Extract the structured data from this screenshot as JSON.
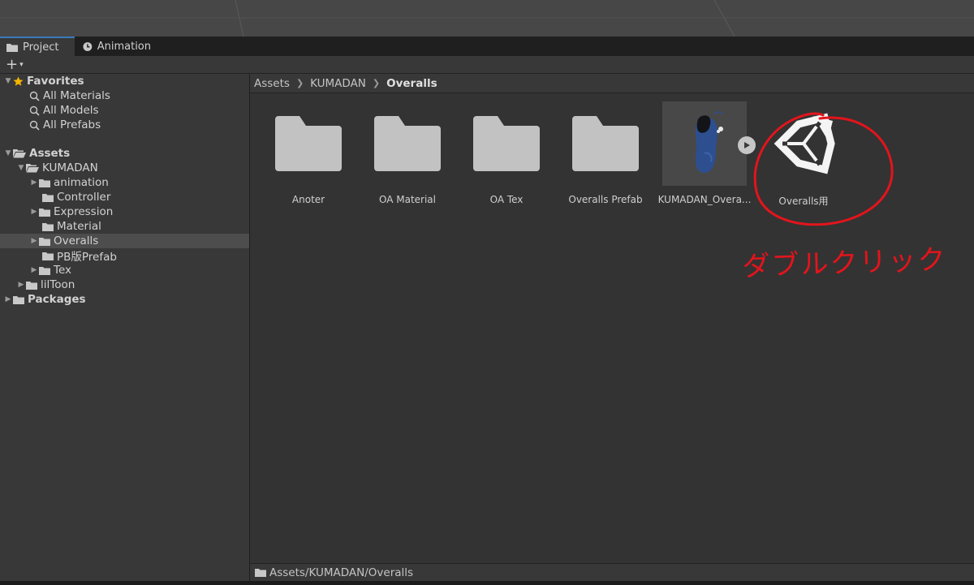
{
  "tabs": [
    {
      "label": "Project",
      "icon": "folder-icon"
    },
    {
      "label": "Animation",
      "icon": "clock-icon"
    }
  ],
  "toolbar": {
    "create_label": "+",
    "create_caret": "▾"
  },
  "tree": {
    "favorites": {
      "label": "Favorites",
      "items": [
        "All Materials",
        "All Models",
        "All Prefabs"
      ]
    },
    "assets": {
      "label": "Assets"
    },
    "kumadan": {
      "label": "KUMADAN"
    },
    "children": [
      "animation",
      "Controller",
      "Expression",
      "Material",
      "Overalls",
      "PB版Prefab",
      "Tex"
    ],
    "liltoon": {
      "label": "lilToon"
    },
    "packages": {
      "label": "Packages"
    }
  },
  "breadcrumb": [
    "Assets",
    "KUMADAN",
    "Overalls"
  ],
  "assets_grid": [
    {
      "name": "Anoter",
      "type": "folder"
    },
    {
      "name": "OA Material",
      "type": "folder"
    },
    {
      "name": "OA Tex",
      "type": "folder"
    },
    {
      "name": "Overalls Prefab",
      "type": "folder"
    },
    {
      "name": "KUMADAN_Overa...",
      "type": "model"
    },
    {
      "name": "Overalls用",
      "type": "unity-scene"
    }
  ],
  "status_path": "Assets/KUMADAN/Overalls",
  "annotation": {
    "text": "ダブルクリック",
    "color": "#e3141c"
  }
}
